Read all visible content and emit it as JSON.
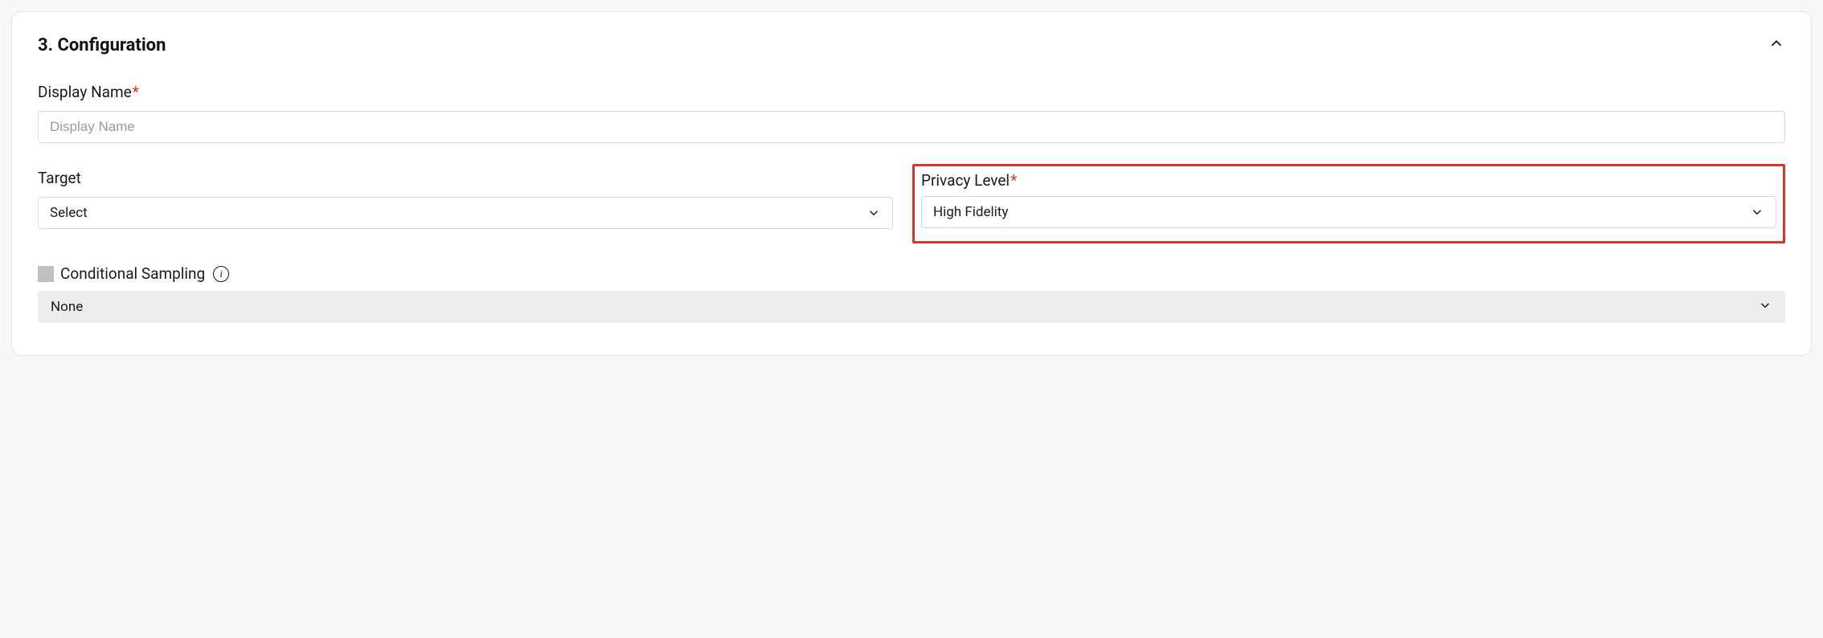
{
  "section": {
    "title": "3. Configuration"
  },
  "display_name": {
    "label": "Display Name",
    "placeholder": "Display Name",
    "value": ""
  },
  "target": {
    "label": "Target",
    "selected": "Select"
  },
  "privacy_level": {
    "label": "Privacy Level",
    "selected": "High Fidelity"
  },
  "conditional_sampling": {
    "label": "Conditional Sampling",
    "checked": false,
    "value": "None"
  },
  "required_marker": "*",
  "info_glyph": "i"
}
